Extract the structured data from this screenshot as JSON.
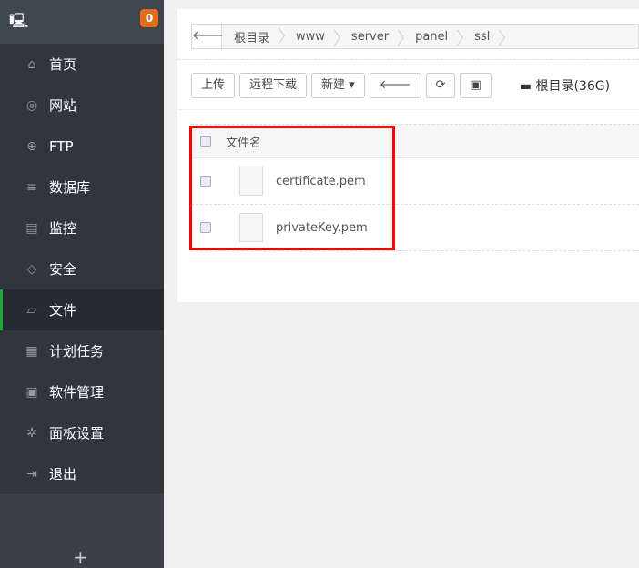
{
  "sidebar": {
    "badge": "0",
    "items": [
      {
        "label": "首页",
        "icon": "home-icon",
        "g": "⌂"
      },
      {
        "label": "网站",
        "icon": "globe-icon",
        "g": "◎"
      },
      {
        "label": "FTP",
        "icon": "ftp-icon",
        "g": "⊕"
      },
      {
        "label": "数据库",
        "icon": "database-icon",
        "g": "≡"
      },
      {
        "label": "监控",
        "icon": "monitor-icon",
        "g": "▤"
      },
      {
        "label": "安全",
        "icon": "shield-icon",
        "g": "◇"
      },
      {
        "label": "文件",
        "icon": "folder-icon",
        "g": "▱"
      },
      {
        "label": "计划任务",
        "icon": "calendar-icon",
        "g": "▦"
      },
      {
        "label": "软件管理",
        "icon": "apps-icon",
        "g": "▣"
      },
      {
        "label": "面板设置",
        "icon": "gear-icon",
        "g": "✲"
      },
      {
        "label": "退出",
        "icon": "logout-icon",
        "g": "⇥"
      }
    ],
    "active": "文件",
    "add": "+"
  },
  "breadcrumb": [
    "根目录",
    "www",
    "server",
    "panel",
    "ssl"
  ],
  "toolbar": {
    "upload": "上传",
    "remote_download": "远程下载",
    "new": "新建 ▾",
    "disk": "根目录(36G)"
  },
  "table": {
    "header": "文件名",
    "files": [
      "certificate.pem",
      "privateKey.pem"
    ]
  }
}
